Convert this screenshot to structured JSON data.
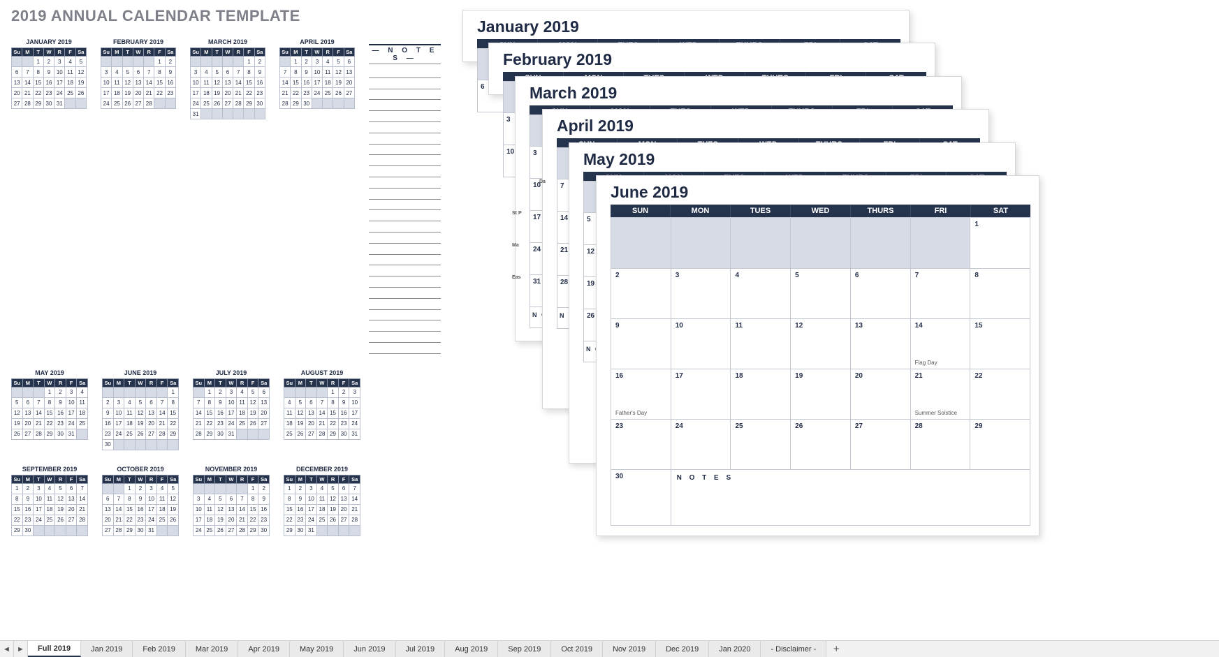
{
  "title": "2019 ANNUAL CALENDAR TEMPLATE",
  "dayHeads": [
    "Su",
    "M",
    "T",
    "W",
    "R",
    "F",
    "Sa"
  ],
  "notesLabel": "N O T E S",
  "months": [
    {
      "name": "JANUARY 2019",
      "start": 2,
      "days": 31
    },
    {
      "name": "FEBRUARY 2019",
      "start": 5,
      "days": 28
    },
    {
      "name": "MARCH 2019",
      "start": 5,
      "days": 31
    },
    {
      "name": "APRIL 2019",
      "start": 1,
      "days": 30
    },
    {
      "name": "MAY 2019",
      "start": 3,
      "days": 31
    },
    {
      "name": "JUNE 2019",
      "start": 6,
      "days": 30
    },
    {
      "name": "JULY 2019",
      "start": 1,
      "days": 31
    },
    {
      "name": "AUGUST 2019",
      "start": 4,
      "days": 31
    },
    {
      "name": "SEPTEMBER 2019",
      "start": 0,
      "days": 30
    },
    {
      "name": "OCTOBER 2019",
      "start": 2,
      "days": 31
    },
    {
      "name": "NOVEMBER 2019",
      "start": 5,
      "days": 30
    },
    {
      "name": "DECEMBER 2019",
      "start": 0,
      "days": 31
    }
  ],
  "bigHeads": [
    "SUN",
    "MON",
    "TUES",
    "WED",
    "THURS",
    "FRI",
    "SAT"
  ],
  "stackTitles": {
    "jan": "January 2019",
    "feb": "February 2019",
    "mar": "March 2019",
    "apr": "April 2019",
    "may": "May 2019",
    "jun": "June 2019"
  },
  "stubVisible": {
    "jan": [
      "",
      "6"
    ],
    "feb": [
      "",
      "3",
      "10"
    ],
    "mar": [
      "",
      "3",
      "10",
      "17",
      "24",
      "31"
    ],
    "apr": [
      "",
      "7",
      "14",
      "21",
      "28"
    ],
    "may": [
      "",
      "5",
      "12",
      "19",
      "26"
    ]
  },
  "stubSide": {
    "marSide": [
      "",
      "",
      "",
      "St P",
      "Ma",
      "Eas"
    ],
    "aprSide": [
      "",
      "Da",
      "",
      "",
      "",
      ""
    ]
  },
  "june": {
    "rows": [
      [
        {
          "d": "",
          "pad": true
        },
        {
          "d": "",
          "pad": true
        },
        {
          "d": "",
          "pad": true
        },
        {
          "d": "",
          "pad": true
        },
        {
          "d": "",
          "pad": true
        },
        {
          "d": "",
          "pad": true
        },
        {
          "d": "1"
        }
      ],
      [
        {
          "d": "2"
        },
        {
          "d": "3"
        },
        {
          "d": "4"
        },
        {
          "d": "5"
        },
        {
          "d": "6"
        },
        {
          "d": "7"
        },
        {
          "d": "8"
        }
      ],
      [
        {
          "d": "9"
        },
        {
          "d": "10"
        },
        {
          "d": "11"
        },
        {
          "d": "12"
        },
        {
          "d": "13"
        },
        {
          "d": "14",
          "ev": "Flag Day"
        },
        {
          "d": "15"
        }
      ],
      [
        {
          "d": "16",
          "ev": "Father's Day"
        },
        {
          "d": "17"
        },
        {
          "d": "18"
        },
        {
          "d": "19"
        },
        {
          "d": "20"
        },
        {
          "d": "21",
          "ev": "Summer Solstice"
        },
        {
          "d": "22"
        }
      ],
      [
        {
          "d": "23"
        },
        {
          "d": "24"
        },
        {
          "d": "25"
        },
        {
          "d": "26"
        },
        {
          "d": "27"
        },
        {
          "d": "28"
        },
        {
          "d": "29"
        }
      ]
    ],
    "last30": "30",
    "notesLabel": "N O T E S"
  },
  "stubNotes": "N O",
  "tabs": [
    "Full 2019",
    "Jan 2019",
    "Feb 2019",
    "Mar 2019",
    "Apr 2019",
    "May 2019",
    "Jun 2019",
    "Jul 2019",
    "Aug 2019",
    "Sep 2019",
    "Oct 2019",
    "Nov 2019",
    "Dec 2019",
    "Jan 2020",
    "- Disclaimer -"
  ],
  "activeTab": 0,
  "arrowL": "◄",
  "arrowR": "►",
  "plus": "+"
}
